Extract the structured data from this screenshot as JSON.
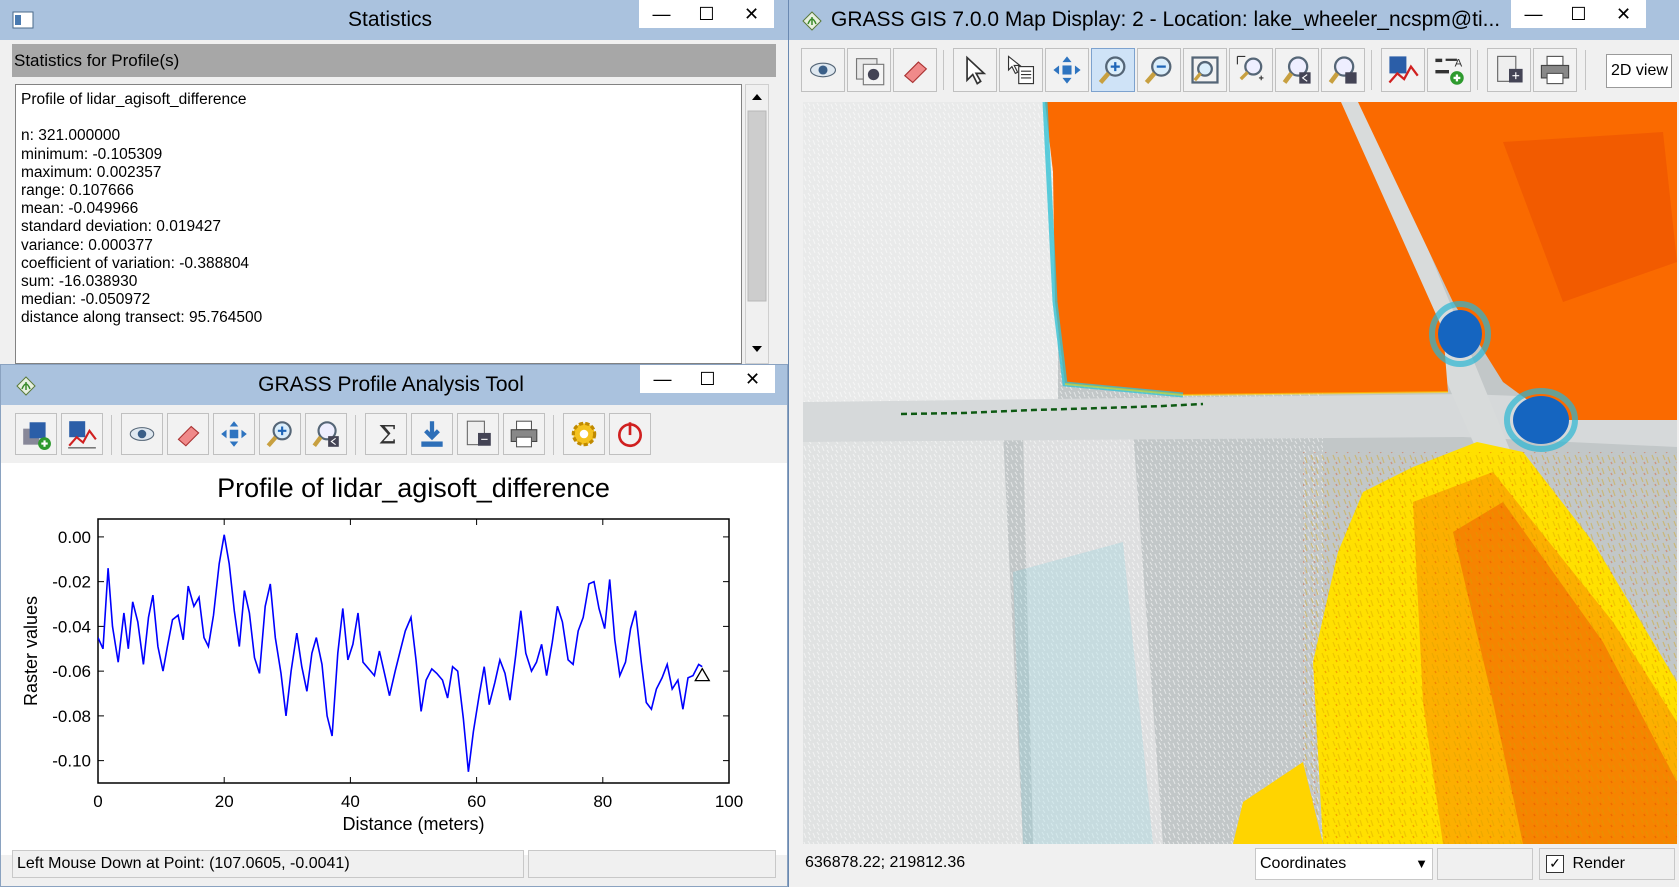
{
  "statistics_window": {
    "title": "Statistics",
    "header": "Statistics for Profile(s)",
    "lines": [
      "Profile of lidar_agisoft_difference",
      "",
      "n: 321.000000",
      "minimum: -0.105309",
      "maximum: 0.002357",
      "range: 0.107666",
      "mean: -0.049966",
      "standard deviation: 0.019427",
      "variance: 0.000377",
      "coefficient of variation: -0.388804",
      "sum: -16.038930",
      "median: -0.050972",
      "distance along transect: 95.764500"
    ]
  },
  "window_buttons": {
    "minimize": "—",
    "maximize": "☐",
    "close": "✕"
  },
  "profile_window": {
    "title": "GRASS Profile Analysis Tool",
    "toolbar": [
      "add-raster-icon",
      "profile-icon",
      "display-icon",
      "erase-icon",
      "pan-icon",
      "zoom-in-icon",
      "zoom-back-icon",
      "statistics-icon",
      "save-icon",
      "options-icon",
      "print-icon",
      "settings-icon",
      "quit-icon"
    ],
    "status_left": "Left Mouse Down at Point: (107.0605, -0.0041)",
    "status_right": ""
  },
  "map_window": {
    "title": "GRASS GIS 7.0.0 Map Display: 2  - Location: lake_wheeler_ncspm@ti...",
    "toolbar": [
      "display-map-icon",
      "render-icon",
      "erase-icon",
      "pointer-icon",
      "query-icon",
      "pan-icon",
      "zoom-in-icon",
      "zoom-out-icon",
      "zoom-extent-icon",
      "zoom-region-icon",
      "zoom-back-icon",
      "zoom-menu-icon",
      "analyze-icon",
      "decorations-icon",
      "save-display-icon",
      "print-icon"
    ],
    "view_mode": "2D view",
    "coordinates": "636878.22; 219812.36",
    "status_mode": "Coordinates",
    "render_label": "Render",
    "render_checked": true,
    "colors": {
      "orange": "#fa6a00",
      "yellow": "#ffe000",
      "gray": "#c2c7c8",
      "white": "#f4f4f4",
      "blue": "#1565c0",
      "cyan": "#28b4d8",
      "transect": "#0d5a12"
    }
  },
  "chart_data": {
    "type": "line",
    "title": "Profile of lidar_agisoft_difference",
    "xlabel": "Distance (meters)",
    "ylabel": "Raster values",
    "xlim": [
      0,
      100
    ],
    "ylim": [
      -0.11,
      0.008
    ],
    "xticks": [
      "0",
      "20",
      "40",
      "60",
      "80",
      "100"
    ],
    "yticks": [
      "0.00",
      "-0.02",
      "-0.04",
      "-0.06",
      "-0.08",
      "-0.10"
    ],
    "grid": false,
    "line_color": "#0000ff",
    "series": [
      {
        "x": [
          0,
          0.8,
          1.6,
          2.3,
          3.2,
          4.1,
          4.8,
          5.5,
          6.3,
          7.2,
          8.0,
          8.7,
          9.5,
          10.3,
          11.0,
          11.8,
          12.7,
          13.5,
          14.3,
          15.2,
          16.0,
          16.8,
          17.5,
          18.3,
          19.2,
          20.0,
          20.8,
          21.6,
          22.4,
          23.2,
          24.0,
          24.8,
          25.6,
          26.5,
          27.3,
          28.1,
          29.0,
          29.8,
          30.6,
          31.5,
          32.3,
          33.1,
          33.9,
          34.6,
          35.5,
          36.3,
          37.1,
          38.0,
          38.8,
          39.6,
          40.4,
          41.2,
          42.0,
          42.9,
          43.8,
          44.6,
          45.4,
          46.2,
          47.1,
          47.9,
          48.7,
          49.6,
          50.4,
          51.2,
          52.0,
          52.9,
          53.7,
          54.6,
          55.4,
          56.2,
          57.0,
          57.9,
          58.7,
          59.5,
          60.4,
          61.2,
          62.0,
          62.9,
          63.7,
          64.5,
          65.3,
          66.2,
          67.0,
          67.8,
          68.7,
          69.5,
          70.3,
          71.1,
          72.0,
          72.8,
          73.6,
          74.5,
          75.3,
          76.1,
          76.9,
          77.8,
          78.6,
          79.4,
          80.3,
          81.1,
          81.9,
          82.7,
          83.6,
          84.4,
          85.2,
          86.1,
          86.9,
          87.7,
          88.5,
          89.4,
          90.2,
          91.0,
          91.9,
          92.7,
          93.5,
          94.3,
          95.2,
          95.76
        ],
        "y": [
          -0.045,
          -0.05,
          -0.014,
          -0.04,
          -0.056,
          -0.034,
          -0.05,
          -0.029,
          -0.038,
          -0.057,
          -0.036,
          -0.026,
          -0.049,
          -0.06,
          -0.049,
          -0.037,
          -0.035,
          -0.046,
          -0.022,
          -0.031,
          -0.027,
          -0.045,
          -0.049,
          -0.035,
          -0.012,
          0.001,
          -0.012,
          -0.033,
          -0.049,
          -0.024,
          -0.034,
          -0.054,
          -0.061,
          -0.031,
          -0.021,
          -0.045,
          -0.061,
          -0.08,
          -0.06,
          -0.043,
          -0.058,
          -0.069,
          -0.052,
          -0.045,
          -0.057,
          -0.08,
          -0.089,
          -0.052,
          -0.032,
          -0.055,
          -0.048,
          -0.034,
          -0.056,
          -0.059,
          -0.062,
          -0.051,
          -0.061,
          -0.071,
          -0.06,
          -0.051,
          -0.042,
          -0.036,
          -0.055,
          -0.078,
          -0.064,
          -0.059,
          -0.061,
          -0.064,
          -0.072,
          -0.058,
          -0.06,
          -0.081,
          -0.105,
          -0.087,
          -0.071,
          -0.058,
          -0.075,
          -0.065,
          -0.055,
          -0.061,
          -0.073,
          -0.053,
          -0.033,
          -0.052,
          -0.06,
          -0.056,
          -0.048,
          -0.062,
          -0.047,
          -0.031,
          -0.038,
          -0.055,
          -0.057,
          -0.042,
          -0.036,
          -0.021,
          -0.02,
          -0.032,
          -0.041,
          -0.019,
          -0.046,
          -0.062,
          -0.056,
          -0.041,
          -0.033,
          -0.056,
          -0.074,
          -0.077,
          -0.068,
          -0.063,
          -0.057,
          -0.068,
          -0.064,
          -0.077,
          -0.063,
          -0.062,
          -0.057,
          -0.058
        ]
      }
    ],
    "marker": {
      "x": 95.76,
      "y": -0.062,
      "shape": "triangle"
    }
  }
}
